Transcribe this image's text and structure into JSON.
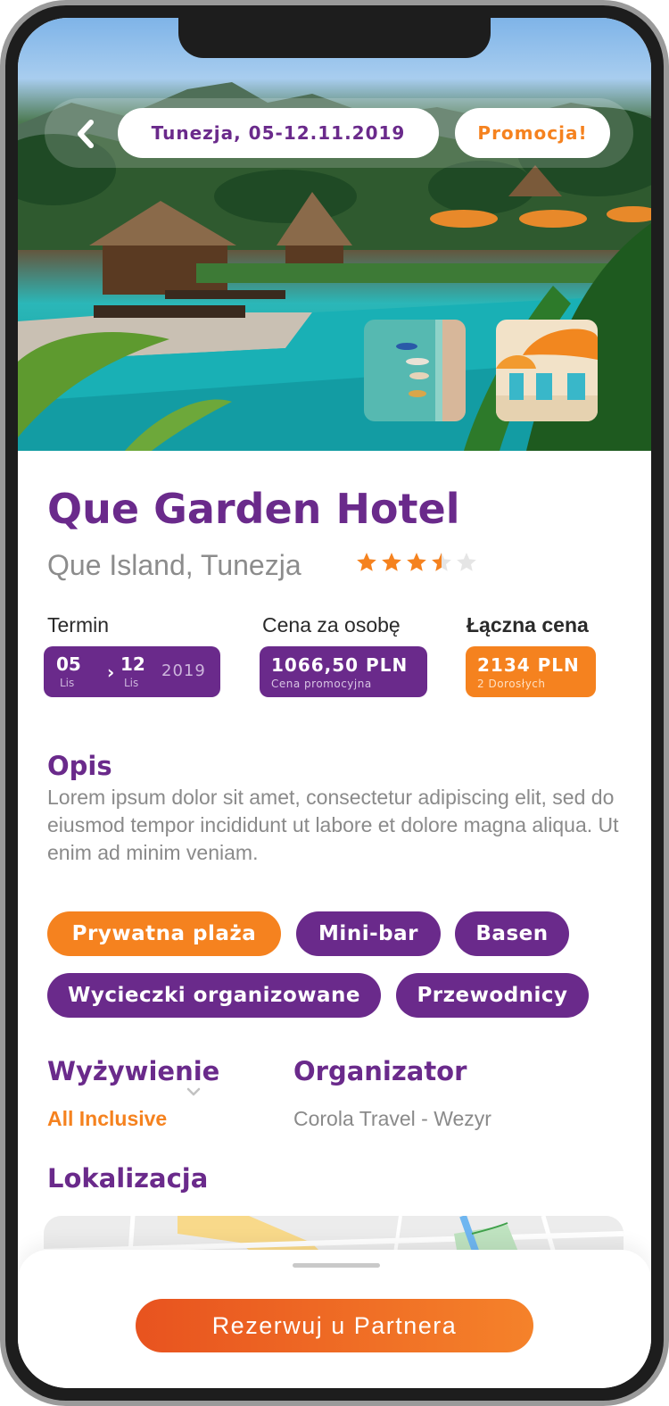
{
  "header": {
    "date_pill": "Tunezja, 05-12.11.2019",
    "promo_pill": "Promocja!"
  },
  "hotel": {
    "name": "Que Garden Hotel",
    "location": "Que Island, Tunezja",
    "rating": 3.5,
    "rating_max": 5
  },
  "term": {
    "label": "Termin",
    "start_day": "05",
    "start_month": "Lis",
    "end_day": "12",
    "end_month": "Lis",
    "year": "2019"
  },
  "price": {
    "label": "Cena za osobę",
    "value": "1066,50 PLN",
    "note": "Cena promocyjna"
  },
  "total": {
    "label": "Łączna cena",
    "value": "2134 PLN",
    "note": "2 Dorosłych"
  },
  "description": {
    "title": "Opis",
    "text": "Lorem ipsum dolor sit amet, consectetur adipiscing elit, sed do eiusmod tempor incididunt ut labore et dolore magna aliqua. Ut enim ad minim veniam."
  },
  "tags": [
    {
      "label": "Prywatna plaża",
      "color": "#f5821f"
    },
    {
      "label": "Mini-bar",
      "color": "#6a2a8b"
    },
    {
      "label": "Basen",
      "color": "#6a2a8b"
    },
    {
      "label": "Wycieczki organizowane",
      "color": "#6a2a8b"
    },
    {
      "label": "Przewodnicy",
      "color": "#6a2a8b"
    }
  ],
  "meal": {
    "title": "Wyżywienie",
    "value": "All Inclusive"
  },
  "organizer": {
    "title": "Organizator",
    "value": "Corola Travel - Wezyr"
  },
  "location_section": {
    "title": "Lokalizacja"
  },
  "cta": {
    "label": "Rezerwuj u Partnera"
  },
  "colors": {
    "primary": "#6a2a8b",
    "accent": "#f5821f",
    "muted": "#8a8a8a"
  },
  "icons": {
    "back": "chevron-left-icon",
    "star": "star-icon",
    "dropdown": "chevron-down-icon"
  }
}
